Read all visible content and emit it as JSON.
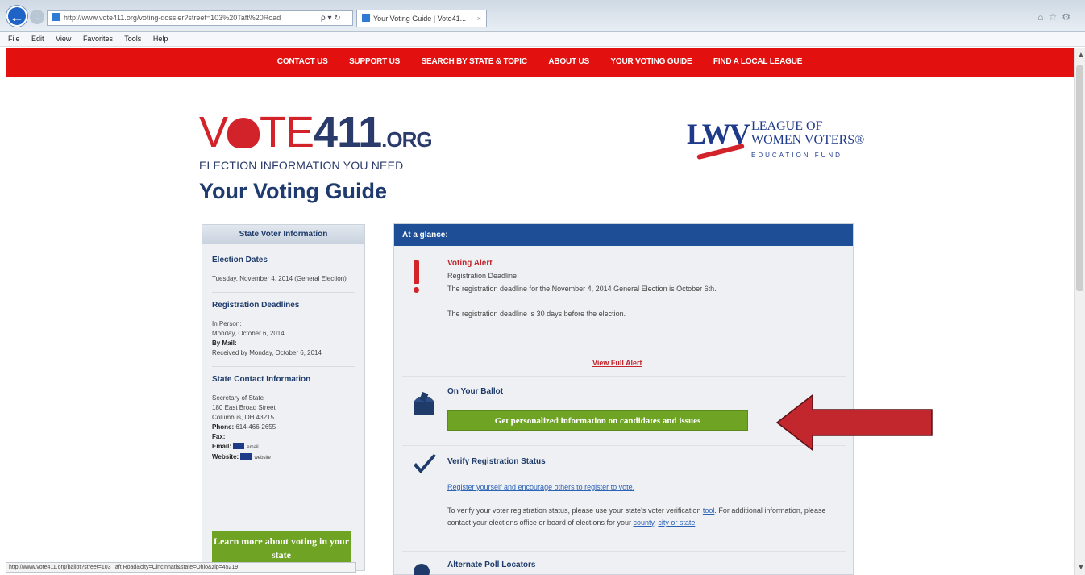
{
  "browser": {
    "url": "http://www.vote411.org/voting-dossier?street=103%20Taft%20Road",
    "tab_title": "Your Voting Guide | Vote41...",
    "tab_close": "×",
    "addr_controls": "ρ ▾ ↻",
    "chrome_icons": "⌂☆⚙",
    "back_glyph": "←",
    "fwd_glyph": "→",
    "menu": [
      "File",
      "Edit",
      "View",
      "Favorites",
      "Tools",
      "Help"
    ],
    "status_text": "http://www.vote411.org/ballot?street=103 Taft Road&city=Cincinnati&state=Ohio&zip=45219"
  },
  "nav": {
    "items": [
      "CONTACT US",
      "SUPPORT US",
      "SEARCH BY STATE & TOPIC",
      "ABOUT US",
      "YOUR VOTING GUIDE",
      "FIND A LOCAL LEAGUE"
    ]
  },
  "logos": {
    "vote_prefix": "V",
    "vote_mid": "TE",
    "vote_num": "411",
    "vote_org": ".ORG",
    "vote_tagline": "ELECTION INFORMATION YOU NEED",
    "lwv_mark": "LWV",
    "lwv_line1": "LEAGUE OF",
    "lwv_line2": "WOMEN VOTERS®",
    "lwv_sub": "EDUCATION FUND"
  },
  "page_title": "Your Voting Guide",
  "left_panel": {
    "header": "State Voter Information",
    "election_dates_h": "Election Dates",
    "election_dates_t": "Tuesday, November 4, 2014 (General Election)",
    "reg_deadlines_h": "Registration Deadlines",
    "in_person_label": "In Person:",
    "in_person_date": "Monday, October 6, 2014",
    "by_mail_label": "By Mail:",
    "by_mail_text": "Received by Monday, October 6, 2014",
    "contact_h": "State Contact Information",
    "office": "Secretary of State",
    "street": "180 East Broad Street",
    "city": "Columbus, OH 43215",
    "phone_label": "Phone:",
    "phone": "614-466-2655",
    "fax_label": "Fax:",
    "email_label": "Email:",
    "email_link": "email",
    "website_label": "Website:",
    "website_link": "website",
    "learn_btn": "Learn more about voting in your state"
  },
  "main_panel": {
    "header": "At a glance:",
    "alert_title": "Voting Alert",
    "alert_line1": "Registration Deadline",
    "alert_line2": "The registration deadline for the November 4, 2014 General Election is October 6th.",
    "alert_line3": "The registration deadline is 30 days before the election.",
    "view_full": "View Full Alert",
    "ballot_title": "On Your Ballot",
    "ballot_btn": "Get personalized information on candidates and issues",
    "verify_title": "Verify Registration Status",
    "verify_link": "Register yourself and encourage others to register to vote.",
    "verify_text_a": "To verify your voter registration status, please use your state's voter verification ",
    "verify_tool": "tool",
    "verify_text_b": ". For additional information, please contact your elections office or board of elections for your ",
    "verify_county": "county",
    "verify_comma": ", ",
    "verify_city": "city or state",
    "poll_title": "Alternate Poll Locators"
  },
  "colors": {
    "nav_red": "#e2110f",
    "header_blue": "#1e4f96",
    "button_green": "#6ea324",
    "arrow_red": "#c1272d"
  }
}
